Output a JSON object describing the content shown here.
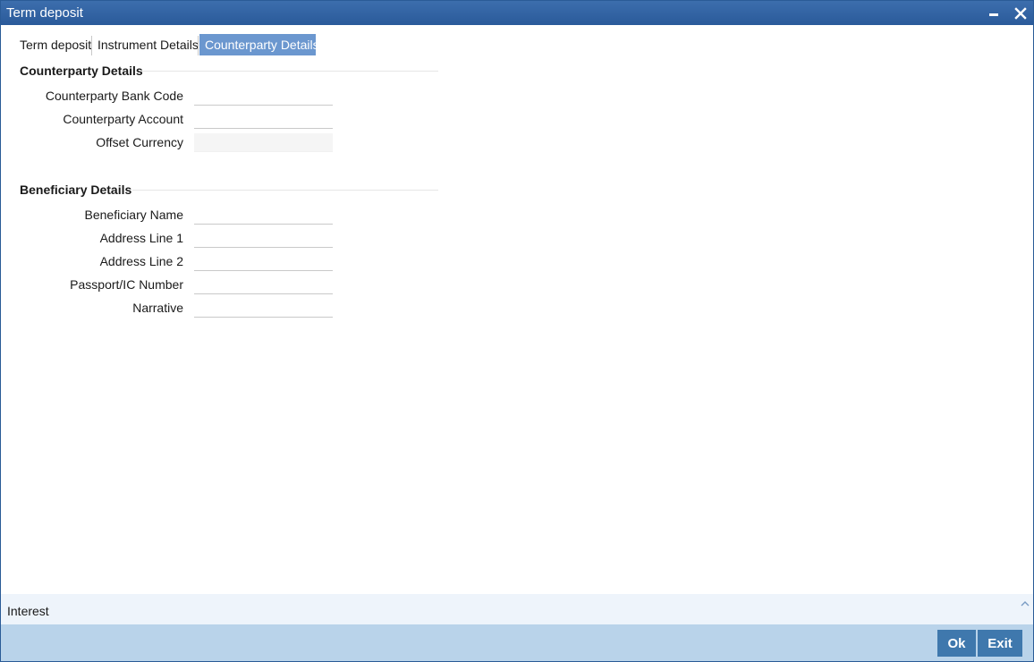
{
  "window": {
    "title": "Term deposit",
    "minimize_icon": "minimize-icon",
    "close_icon": "close-icon"
  },
  "tabs": [
    {
      "label": "Term deposit",
      "active": false
    },
    {
      "label": "Instrument Details",
      "active": false
    },
    {
      "label": "Counterparty Details",
      "active": true
    }
  ],
  "counterparty": {
    "section_title": "Counterparty Details",
    "fields": [
      {
        "label": "Counterparty Bank Code",
        "value": ""
      },
      {
        "label": "Counterparty Account",
        "value": ""
      },
      {
        "label": "Offset Currency",
        "value": ""
      }
    ]
  },
  "beneficiary": {
    "section_title": "Beneficiary Details",
    "fields": [
      {
        "label": "Beneficiary Name",
        "value": ""
      },
      {
        "label": "Address Line 1",
        "value": ""
      },
      {
        "label": "Address Line 2",
        "value": ""
      },
      {
        "label": "Passport/IC Number",
        "value": ""
      },
      {
        "label": "Narrative",
        "value": ""
      }
    ]
  },
  "footer": {
    "section_label": "Interest",
    "expand_icon": "chevron-up-icon"
  },
  "actions": {
    "ok_label": "Ok",
    "exit_label": "Exit"
  },
  "colors": {
    "titlebar": "#2a5a9a",
    "active_tab": "#6b97cf",
    "action_bar": "#b9d3ea",
    "action_button": "#3f78ad"
  }
}
